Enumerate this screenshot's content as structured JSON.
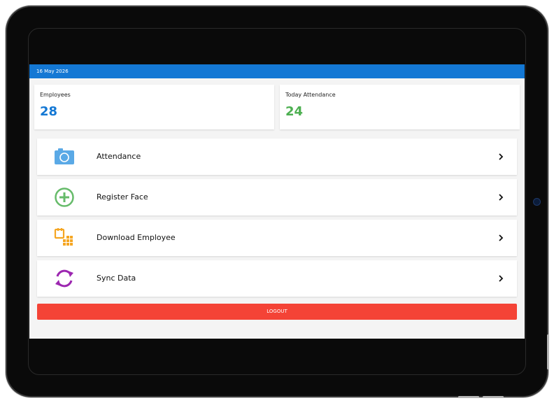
{
  "status_bar": {
    "date": "16 May 2026",
    "color": "#1478d4"
  },
  "stats": [
    {
      "label": "Employees",
      "value": "28",
      "color": "#1478d4"
    },
    {
      "label": "Today Attendance",
      "value": "24",
      "color": "#4caf50"
    }
  ],
  "menu": [
    {
      "label": "Attendance",
      "icon": "camera-icon",
      "color": "#5aa9e6"
    },
    {
      "label": "Register Face",
      "icon": "add-circle-icon",
      "color": "#4caf50"
    },
    {
      "label": "Download Employee",
      "icon": "download-grid-icon",
      "color": "#f5a623"
    },
    {
      "label": "Sync Data",
      "icon": "sync-icon",
      "color": "#9c27b0"
    }
  ],
  "logout": {
    "label": "LOGOUT",
    "color": "#f44336"
  }
}
